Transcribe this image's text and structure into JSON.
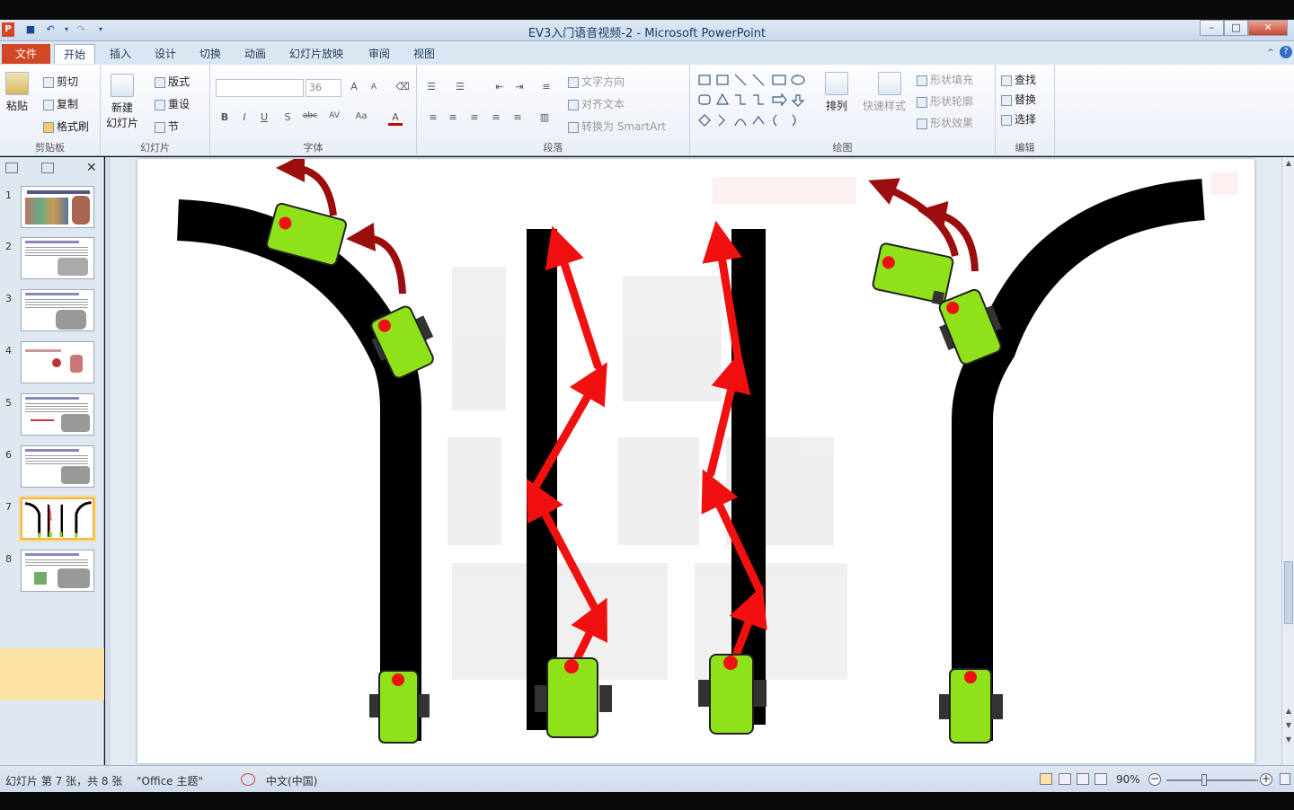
{
  "window": {
    "app_icon": "P",
    "title": "EV3入门语音视频-2 - Microsoft PowerPoint",
    "minimize": "–",
    "maximize": "□",
    "close": "✕"
  },
  "tabs": {
    "file": "文件",
    "items": [
      "开始",
      "插入",
      "设计",
      "切换",
      "动画",
      "幻灯片放映",
      "审阅",
      "视图"
    ],
    "active": "开始"
  },
  "ribbon": {
    "clipboard": {
      "label": "剪贴板",
      "paste": "粘贴",
      "cut": "剪切",
      "copy": "复制",
      "format_painter": "格式刷"
    },
    "slides": {
      "label": "幻灯片",
      "new_slide_line1": "新建",
      "new_slide_line2": "幻灯片",
      "layout": "版式",
      "reset": "重设",
      "section": "节"
    },
    "font": {
      "label": "字体",
      "font_size": "36",
      "bold": "B",
      "italic": "I",
      "underline": "U",
      "shadow": "S",
      "strike": "abc",
      "spacing": "AV",
      "case": "Aa",
      "color": "A",
      "grow": "A",
      "shrink": "A"
    },
    "paragraph": {
      "label": "段落",
      "text_direction": "文字方向",
      "align_text": "对齐文本",
      "smartart": "转换为 SmartArt"
    },
    "drawing": {
      "label": "绘图",
      "arrange": "排列",
      "quick_styles": "快速样式",
      "shape_fill": "形状填充",
      "shape_outline": "形状轮廓",
      "shape_effects": "形状效果"
    },
    "editing": {
      "label": "编辑",
      "find": "查找",
      "replace": "替换",
      "select": "选择"
    }
  },
  "slides_pane": {
    "numbers": [
      "1",
      "2",
      "3",
      "4",
      "5",
      "6",
      "7",
      "8"
    ],
    "selected": 7
  },
  "status": {
    "slide_info": "幻灯片 第 7 张，共 8 张",
    "theme": "\"Office 主题\"",
    "language": "中文(中国)",
    "zoom": "90%"
  },
  "colors": {
    "robot": "#8fe11a",
    "arrow_red": "#f01010",
    "turn_arrow": "#9c0e0e",
    "file_tab": "#d24726"
  }
}
